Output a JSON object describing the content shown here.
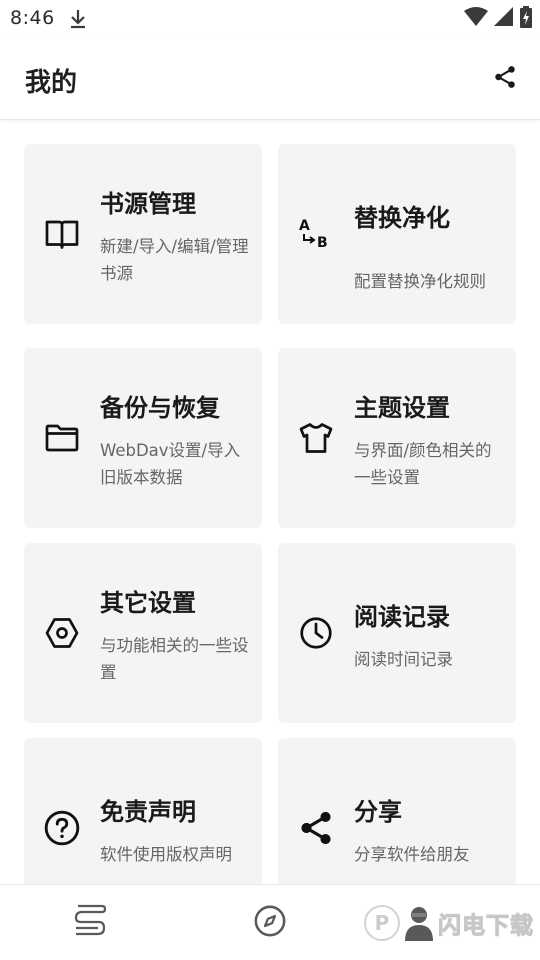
{
  "status_bar": {
    "time": "8:46",
    "icons": [
      "download-icon",
      "wifi-icon",
      "cell-signal-icon",
      "battery-charging-icon"
    ]
  },
  "app_bar": {
    "title": "我的",
    "action_icon": "share-icon"
  },
  "cards": [
    {
      "icon": "book-icon",
      "title": "书源管理",
      "subtitle": "新建/导入/编辑/管理书源"
    },
    {
      "icon": "a-to-b-replace-icon",
      "title": "替换净化",
      "subtitle": "配置替换净化规则"
    },
    {
      "icon": "folder-icon",
      "title": "备份与恢复",
      "subtitle": "WebDav设置/导入旧版本数据"
    },
    {
      "icon": "tshirt-icon",
      "title": "主题设置",
      "subtitle": "与界面/颜色相关的一些设置"
    },
    {
      "icon": "hexagon-settings-icon",
      "title": "其它设置",
      "subtitle": "与功能相关的一些设置"
    },
    {
      "icon": "clock-icon",
      "title": "阅读记录",
      "subtitle": "阅读时间记录"
    },
    {
      "icon": "help-circle-icon",
      "title": "免责声明",
      "subtitle": "软件使用版权声明"
    },
    {
      "icon": "share-icon",
      "title": "分享",
      "subtitle": "分享软件给朋友"
    }
  ],
  "bottom_nav": {
    "items": [
      {
        "icon": "bookshelf-icon"
      },
      {
        "icon": "compass-icon"
      },
      {
        "icon": "my-profile-icon"
      }
    ]
  },
  "watermark": {
    "text": "闪电下载"
  }
}
